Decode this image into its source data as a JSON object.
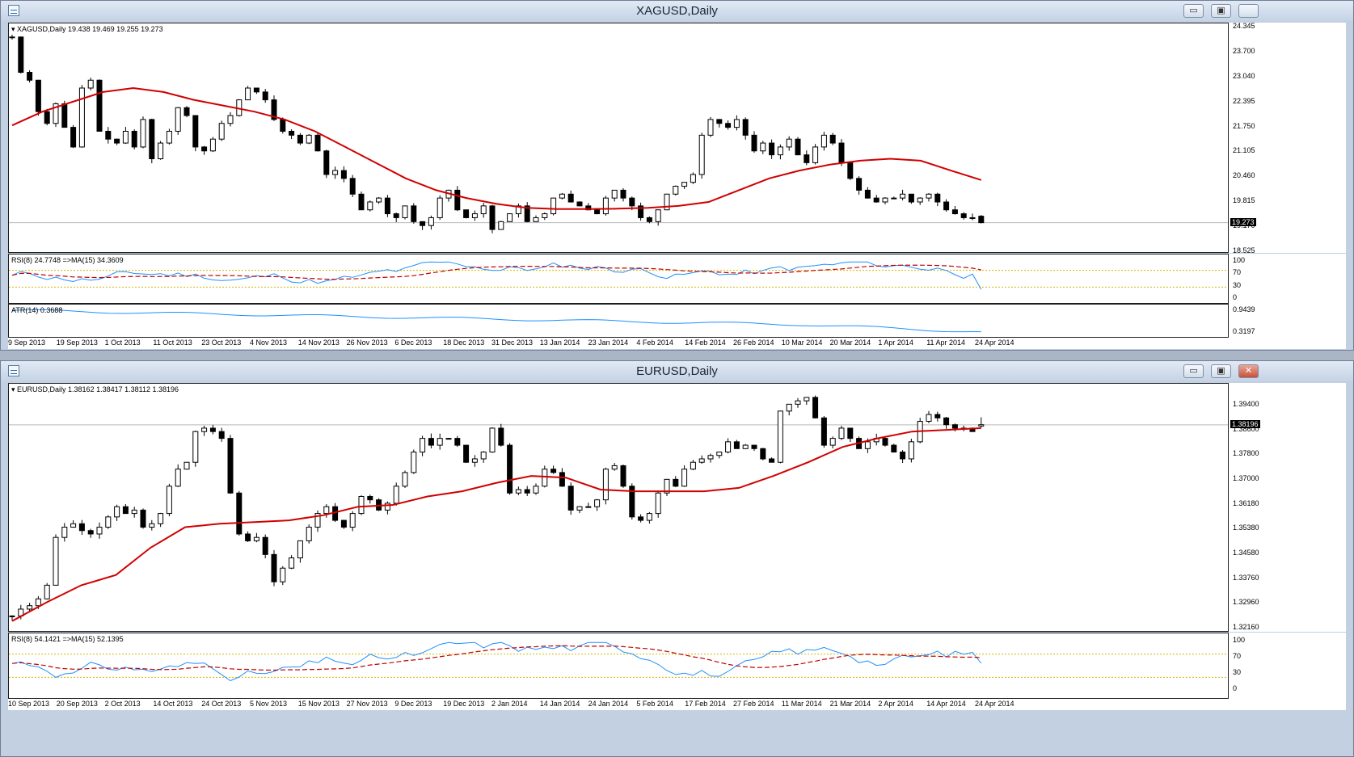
{
  "windows": [
    {
      "key": "xag",
      "title": "XAGUSD,Daily",
      "buttons": {
        "minimize": "▭",
        "maximize": "▣",
        "close": ""
      },
      "main": {
        "info": "XAGUSD,Daily  19.438 19.469 19.255 19.273",
        "scale": [
          "24.345",
          "23.700",
          "23.040",
          "22.395",
          "21.750",
          "21.105",
          "20.460",
          "19.815",
          "19.170",
          "18.525"
        ],
        "price_label": "19.273"
      },
      "rsi": {
        "info": "RSI(8) 24.7748   =>MA(15) 34.3609",
        "scale": [
          "100",
          "70",
          "30",
          "0"
        ]
      },
      "atr": {
        "info": "ATR(14) 0.3688",
        "scale": [
          "0.9439",
          "0.3197"
        ]
      },
      "dates": [
        "9 Sep 2013",
        "19 Sep 2013",
        "1 Oct 2013",
        "11 Oct 2013",
        "23 Oct 2013",
        "4 Nov 2013",
        "14 Nov 2013",
        "26 Nov 2013",
        "6 Dec 2013",
        "18 Dec 2013",
        "31 Dec 2013",
        "13 Jan 2014",
        "23 Jan 2014",
        "4 Feb 2014",
        "14 Feb 2014",
        "26 Feb 2014",
        "10 Mar 2014",
        "20 Mar 2014",
        "1 Apr 2014",
        "11 Apr 2014",
        "24 Apr 2014"
      ]
    },
    {
      "key": "eur",
      "title": "EURUSD,Daily",
      "buttons": {
        "minimize": "▭",
        "maximize": "▣",
        "close": "✕"
      },
      "main": {
        "info": "EURUSD,Daily  1.38162 1.38417 1.38112 1.38196",
        "scale": [
          "1.39400",
          "1.38600",
          "1.37800",
          "1.37000",
          "1.36180",
          "1.35380",
          "1.34580",
          "1.33760",
          "1.32960",
          "1.32160"
        ],
        "price_label": "1.38196"
      },
      "rsi": {
        "info": "RSI(8) 54.1421   =>MA(15) 52.1395",
        "scale": [
          "100",
          "70",
          "30",
          "0"
        ]
      },
      "dates": [
        "10 Sep 2013",
        "20 Sep 2013",
        "2 Oct 2013",
        "14 Oct 2013",
        "24 Oct 2013",
        "5 Nov 2013",
        "15 Nov 2013",
        "27 Nov 2013",
        "9 Dec 2013",
        "19 Dec 2013",
        "2 Jan 2014",
        "14 Jan 2014",
        "24 Jan 2014",
        "5 Feb 2014",
        "17 Feb 2014",
        "27 Feb 2014",
        "11 Mar 2014",
        "21 Mar 2014",
        "2 Apr 2014",
        "14 Apr 2014",
        "24 Apr 2014"
      ]
    }
  ],
  "chart_data": [
    {
      "type": "candlestick",
      "title": "XAGUSD,Daily",
      "ylim": [
        18.525,
        24.345
      ],
      "current_price": 19.273,
      "ohlc_last": {
        "open": 19.438,
        "high": 19.469,
        "low": 19.255,
        "close": 19.273
      },
      "closes": [
        24.0,
        23.1,
        22.9,
        22.1,
        21.8,
        22.3,
        21.7,
        21.2,
        22.7,
        22.9,
        21.6,
        21.4,
        21.3,
        21.6,
        21.2,
        21.9,
        20.9,
        21.3,
        21.6,
        22.2,
        22.0,
        21.2,
        21.1,
        21.4,
        21.8,
        22.0,
        22.4,
        22.7,
        22.6,
        22.4,
        21.9,
        21.6,
        21.5,
        21.3,
        21.5,
        21.1,
        20.5,
        20.6,
        20.4,
        20.0,
        19.6,
        19.8,
        19.9,
        19.5,
        19.4,
        19.7,
        19.3,
        19.2,
        19.4,
        19.9,
        20.1,
        19.6,
        19.4,
        19.5,
        19.7,
        19.1,
        19.3,
        19.5,
        19.7,
        19.3,
        19.4,
        19.5,
        19.9,
        20.0,
        19.8,
        19.7,
        19.6,
        19.5,
        19.9,
        20.1,
        19.9,
        19.7,
        19.4,
        19.3,
        19.6,
        20.0,
        20.2,
        20.3,
        20.5,
        21.5,
        21.9,
        21.8,
        21.7,
        21.9,
        21.5,
        21.1,
        21.3,
        21.0,
        21.2,
        21.4,
        21.0,
        20.8,
        21.2,
        21.5,
        21.3,
        20.8,
        20.4,
        20.1,
        19.9,
        19.8,
        19.9,
        19.9,
        20.0,
        19.8,
        19.9,
        20.0,
        19.8,
        19.6,
        19.5,
        19.4,
        19.4,
        19.273
      ],
      "ma_closes": [
        21.75,
        22.1,
        22.35,
        22.6,
        22.7,
        22.6,
        22.4,
        22.25,
        22.1,
        21.9,
        21.6,
        21.2,
        20.8,
        20.4,
        20.1,
        19.9,
        19.75,
        19.65,
        19.62,
        19.62,
        19.63,
        19.65,
        19.7,
        19.8,
        20.1,
        20.4,
        20.6,
        20.75,
        20.85,
        20.9,
        20.85,
        20.6,
        20.36
      ],
      "rsi_series": [
        {
          "name": "RSI(8)",
          "last": 24.7748
        },
        {
          "name": "MA(15)",
          "last": 34.3609
        }
      ],
      "atr": {
        "name": "ATR(14)",
        "last": 0.3688,
        "ylim": [
          0.3197,
          0.9439
        ]
      },
      "xlabel": "",
      "ylabel": ""
    },
    {
      "type": "candlestick",
      "title": "EURUSD,Daily",
      "ylim": [
        1.3216,
        1.394
      ],
      "current_price": 1.38196,
      "ohlc_last": {
        "open": 1.38162,
        "high": 1.38417,
        "low": 1.38112,
        "close": 1.38196
      },
      "closes": [
        1.326,
        1.328,
        1.329,
        1.331,
        1.335,
        1.349,
        1.352,
        1.353,
        1.351,
        1.35,
        1.352,
        1.355,
        1.358,
        1.356,
        1.357,
        1.352,
        1.353,
        1.356,
        1.364,
        1.369,
        1.371,
        1.38,
        1.381,
        1.38,
        1.378,
        1.362,
        1.35,
        1.348,
        1.349,
        1.344,
        1.336,
        1.34,
        1.343,
        1.348,
        1.352,
        1.356,
        1.358,
        1.354,
        1.352,
        1.356,
        1.361,
        1.36,
        1.357,
        1.359,
        1.364,
        1.368,
        1.374,
        1.378,
        1.376,
        1.378,
        1.378,
        1.376,
        1.371,
        1.372,
        1.374,
        1.381,
        1.376,
        1.362,
        1.363,
        1.362,
        1.364,
        1.369,
        1.368,
        1.364,
        1.357,
        1.358,
        1.358,
        1.36,
        1.369,
        1.37,
        1.364,
        1.355,
        1.354,
        1.356,
        1.362,
        1.366,
        1.364,
        1.369,
        1.371,
        1.372,
        1.373,
        1.374,
        1.377,
        1.375,
        1.376,
        1.375,
        1.372,
        1.371,
        1.386,
        1.388,
        1.389,
        1.39,
        1.384,
        1.376,
        1.378,
        1.381,
        1.378,
        1.375,
        1.377,
        1.378,
        1.376,
        1.374,
        1.372,
        1.377,
        1.383,
        1.385,
        1.384,
        1.382,
        1.381,
        1.381,
        1.38,
        1.382
      ],
      "ma_closes": [
        1.3245,
        1.33,
        1.335,
        1.338,
        1.346,
        1.352,
        1.353,
        1.3535,
        1.354,
        1.3555,
        1.358,
        1.3585,
        1.361,
        1.3625,
        1.365,
        1.367,
        1.3665,
        1.363,
        1.3625,
        1.3625,
        1.3625,
        1.3635,
        1.367,
        1.371,
        1.3755,
        1.378,
        1.38,
        1.3805,
        1.381
      ],
      "rsi_series": [
        {
          "name": "RSI(8)",
          "last": 54.1421
        },
        {
          "name": "MA(15)",
          "last": 52.1395
        }
      ],
      "xlabel": "",
      "ylabel": ""
    }
  ]
}
